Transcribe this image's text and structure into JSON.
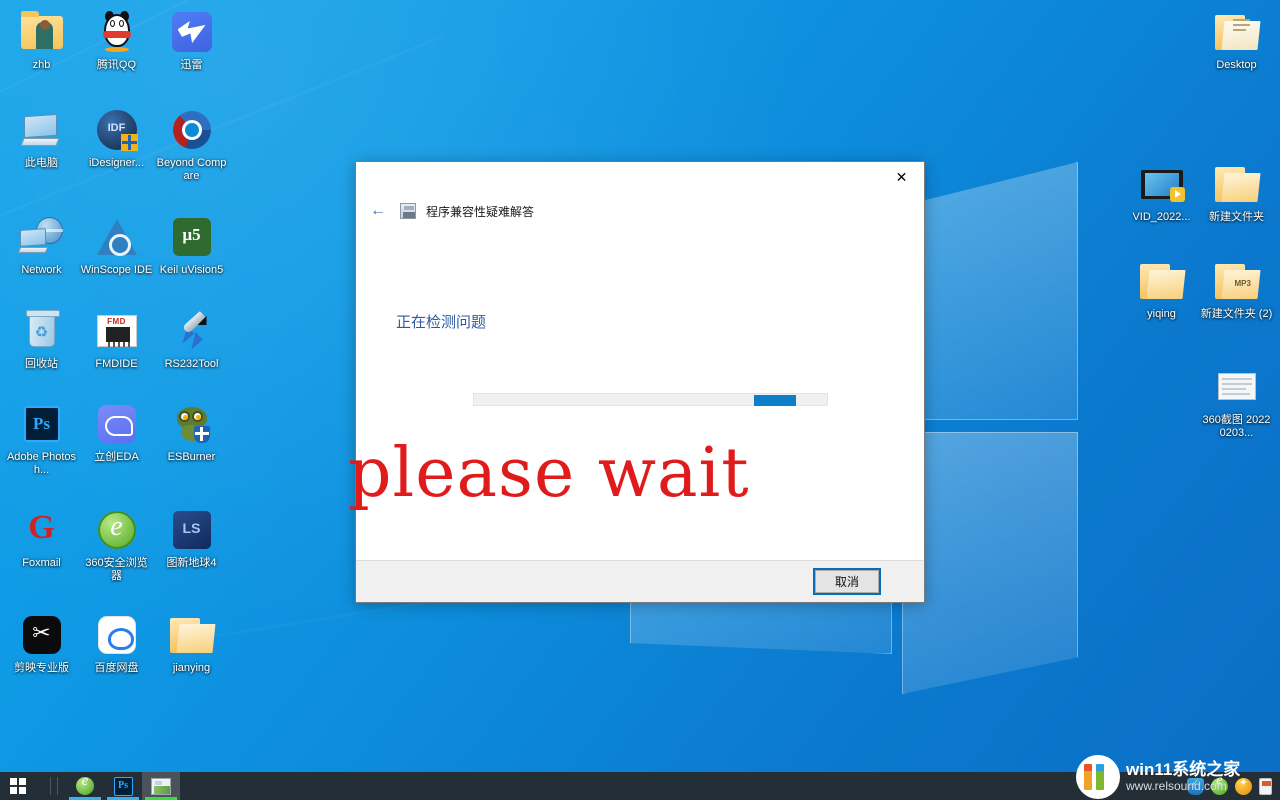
{
  "desktop": {
    "wallpaper_color": "#0d8ada",
    "icons_left": [
      [
        {
          "label": "zhb",
          "icon": "folder-user-icon"
        },
        {
          "label": "腾讯QQ",
          "icon": "tencent-qq-icon"
        },
        {
          "label": "迅雷",
          "icon": "thunder-download-icon"
        }
      ],
      [
        {
          "label": "此电脑",
          "icon": "this-pc-icon"
        },
        {
          "label": "iDesigner...",
          "icon": "idesigner-icon"
        },
        {
          "label": "Beyond Compare",
          "icon": "beyond-compare-icon"
        }
      ],
      [
        {
          "label": "Network",
          "icon": "network-icon"
        },
        {
          "label": "WinScope IDE",
          "icon": "winscope-ide-icon"
        },
        {
          "label": "Keil uVision5",
          "icon": "keil-uvision5-icon"
        }
      ],
      [
        {
          "label": "回收站",
          "icon": "recycle-bin-icon"
        },
        {
          "label": "FMDIDE",
          "icon": "fmdide-chip-icon"
        },
        {
          "label": "RS232Tool",
          "icon": "rs232tool-rocket-icon"
        }
      ],
      [
        {
          "label": "Adobe Photosh...",
          "icon": "adobe-photoshop-icon"
        },
        {
          "label": "立创EDA",
          "icon": "lceda-icon"
        },
        {
          "label": "ESBurner",
          "icon": "esburner-owl-icon"
        }
      ],
      [
        {
          "label": "Foxmail",
          "icon": "foxmail-icon"
        },
        {
          "label": "360安全浏览器",
          "icon": "360-browser-icon"
        },
        {
          "label": "图新地球4",
          "icon": "tuxin-earth4-icon"
        }
      ],
      [
        {
          "label": "剪映专业版",
          "icon": "jianying-pro-icon"
        },
        {
          "label": "百度网盘",
          "icon": "baidu-netdisk-icon"
        },
        {
          "label": "jianying",
          "icon": "folder-open-icon"
        }
      ]
    ],
    "icons_right": [
      [
        {
          "label": "",
          "icon": "empty"
        },
        {
          "label": "Desktop",
          "icon": "folder-documents-icon"
        }
      ],
      [
        {
          "label": "VID_2022...",
          "icon": "video-file-icon"
        },
        {
          "label": "新建文件夹",
          "icon": "folder-icon"
        }
      ],
      [
        {
          "label": "yiqing",
          "icon": "folder-open-icon"
        },
        {
          "label": "新建文件夹 (2)",
          "icon": "folder-mp3-icon"
        }
      ],
      [
        {
          "label": "",
          "icon": "empty"
        },
        {
          "label": "360截图 20220203...",
          "icon": "screenshot-file-icon"
        }
      ]
    ]
  },
  "dialog": {
    "title": "程序兼容性疑难解答",
    "app_icon": "troubleshooter-icon",
    "back_label": "←",
    "close_label": "✕",
    "status": "正在检测问题",
    "overlay_text": "please wait",
    "overlay_color": "#e01b1b",
    "progress": {
      "indeterminate": true,
      "chunk_position_percent": 79,
      "track_color": "#f0f0f0",
      "chunk_color": "#0d7ec8"
    },
    "cancel_label": "取消"
  },
  "taskbar": {
    "background": "#242e36",
    "start_label": "开始",
    "items": [
      {
        "label": "360安全浏览器",
        "icon": "360-browser-icon",
        "state": "running"
      },
      {
        "label": "Adobe Photoshop",
        "icon": "adobe-photoshop-icon",
        "state": "running"
      },
      {
        "label": "程序兼容性疑难解答",
        "icon": "troubleshooter-icon",
        "state": "active"
      }
    ],
    "tray": [
      {
        "label": "360安全卫士",
        "icon": "shield-check-icon"
      },
      {
        "label": "360安全浏览器",
        "icon": "360-browser-icon"
      },
      {
        "label": "360软件管家",
        "icon": "star-burst-icon"
      },
      {
        "label": "安全删除硬件并弹出媒体",
        "icon": "usb-eject-icon"
      }
    ]
  },
  "watermark": {
    "title": "win11系统之家",
    "url": "www.relsound.com"
  }
}
